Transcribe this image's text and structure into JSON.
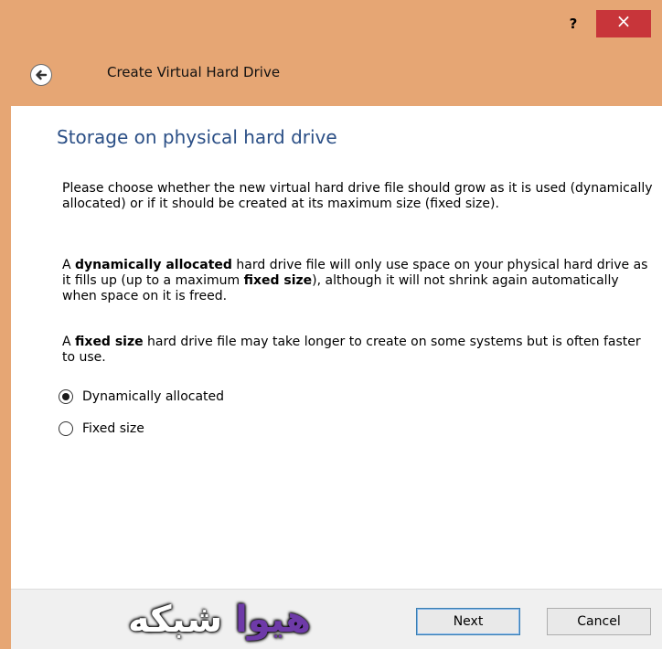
{
  "titlebar": {
    "help_label": "?",
    "close_label": "×"
  },
  "wizard": {
    "title": "Create Virtual Hard Drive"
  },
  "page": {
    "heading": "Storage on physical hard drive",
    "intro": "Please choose whether the new virtual hard drive file should grow as it is used (dynamically allocated) or if it should be created at its maximum size (fixed size).",
    "dynamic_para": {
      "prefix": "A ",
      "bold1": "dynamically allocated",
      "middle": " hard drive file will only use space on your physical hard drive as it fills up (up to a maximum ",
      "bold2": "fixed size",
      "suffix": "), although it will not shrink again automatically when space on it is freed."
    },
    "fixed_para": {
      "prefix": "A ",
      "bold1": "fixed size",
      "suffix": " hard drive file may take longer to create on some systems but is often faster to use."
    }
  },
  "options": [
    {
      "label": "Dynamically allocated",
      "checked": true
    },
    {
      "label": "Fixed size",
      "checked": false
    }
  ],
  "buttons": {
    "next_label": "Next",
    "cancel_label": "Cancel"
  },
  "watermark": {
    "part1": "هیوا",
    "part2": " شبکه"
  },
  "colors": {
    "chrome": "#e6a674",
    "close": "#c8353a",
    "heading": "#2b4f86"
  }
}
